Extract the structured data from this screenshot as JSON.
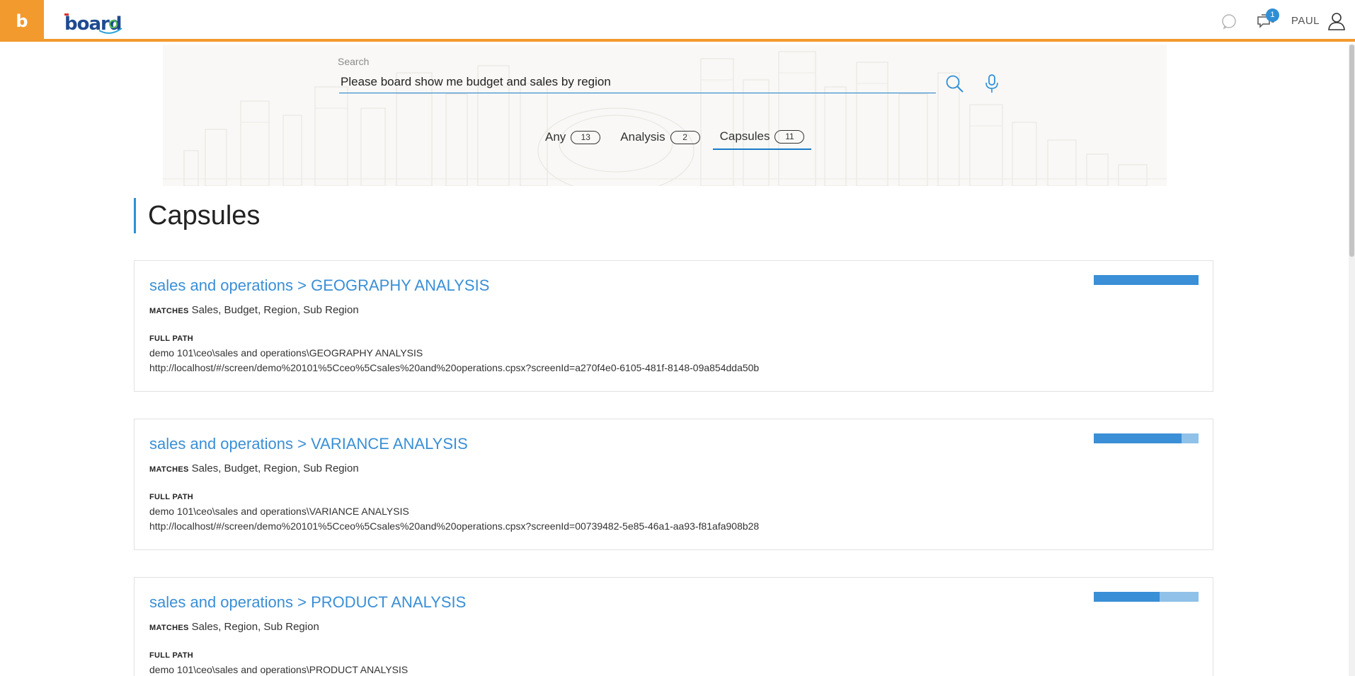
{
  "header": {
    "app_letter": "b",
    "logo_text": "board",
    "notifications_count": "1",
    "user_name": "PAUL"
  },
  "search": {
    "label": "Search",
    "value": "Please board show me budget and sales by region"
  },
  "tabs": [
    {
      "label": "Any",
      "count": "13",
      "active": false
    },
    {
      "label": "Analysis",
      "count": "2",
      "active": false
    },
    {
      "label": "Capsules",
      "count": "11",
      "active": true
    }
  ],
  "section_title": "Capsules",
  "labels": {
    "matches": "MATCHES",
    "full_path": "FULL PATH"
  },
  "results": [
    {
      "title": "sales and operations > GEOGRAPHY ANALYSIS",
      "matches": "Sales, Budget, Region, Sub Region",
      "path": "demo 101\\ceo\\sales and operations\\GEOGRAPHY ANALYSIS",
      "url": "http://localhost/#/screen/demo%20101%5Cceo%5Csales%20and%20operations.cpsx?screenId=a270f4e0-6105-481f-8148-09a854dda50b",
      "score": 1.0
    },
    {
      "title": "sales and operations > VARIANCE ANALYSIS",
      "matches": "Sales, Budget, Region, Sub Region",
      "path": "demo 101\\ceo\\sales and operations\\VARIANCE ANALYSIS",
      "url": "http://localhost/#/screen/demo%20101%5Cceo%5Csales%20and%20operations.cpsx?screenId=00739482-5e85-46a1-aa93-f81afa908b28",
      "score": 0.84
    },
    {
      "title": "sales and operations > PRODUCT ANALYSIS",
      "matches": "Sales, Region, Sub Region",
      "path": "demo 101\\ceo\\sales and operations\\PRODUCT ANALYSIS",
      "url": "",
      "score": 0.63
    }
  ],
  "colors": {
    "accent_orange": "#f39a2e",
    "accent_blue": "#3a8fd6",
    "score_light": "#90c1e8"
  }
}
